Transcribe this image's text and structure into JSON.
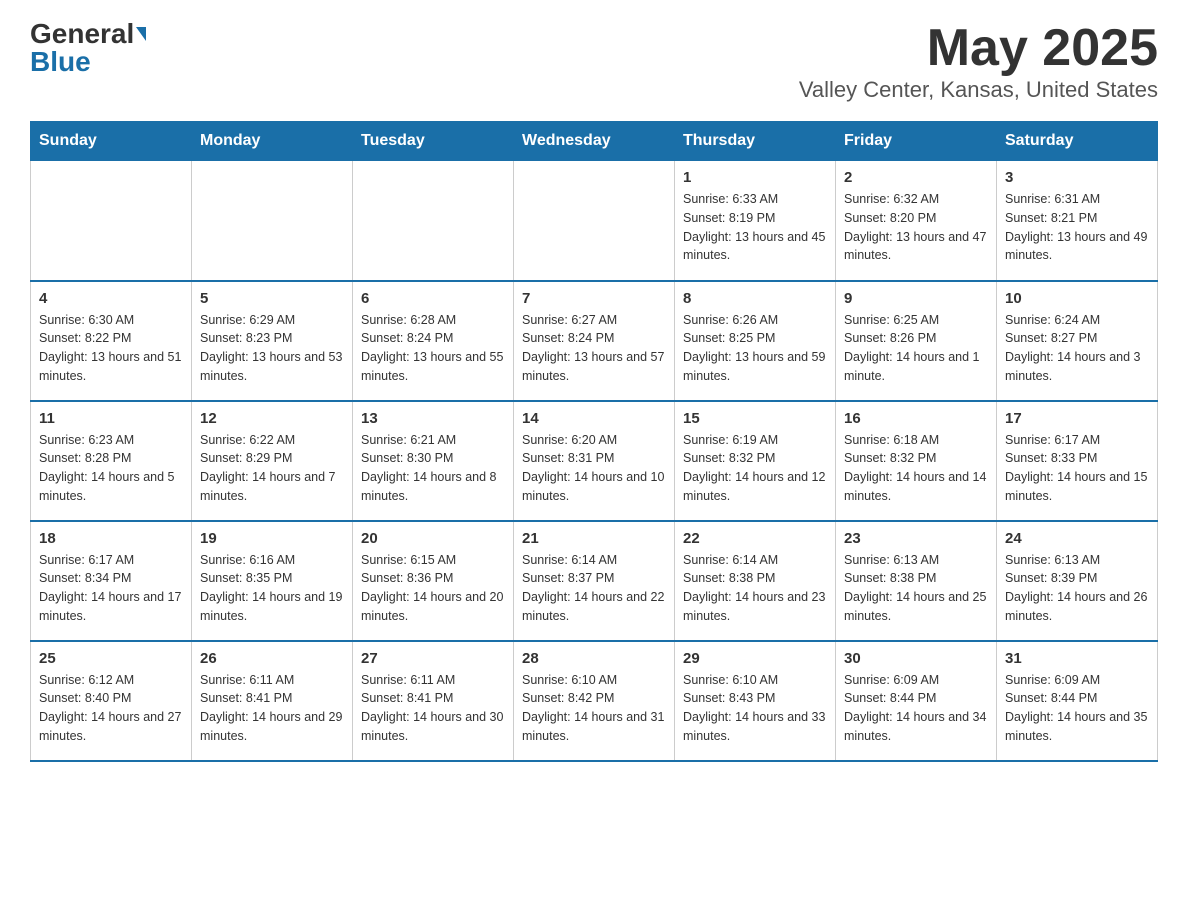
{
  "header": {
    "logo_general": "General",
    "logo_blue": "Blue",
    "month": "May 2025",
    "location": "Valley Center, Kansas, United States"
  },
  "days_of_week": [
    "Sunday",
    "Monday",
    "Tuesday",
    "Wednesday",
    "Thursday",
    "Friday",
    "Saturday"
  ],
  "weeks": [
    [
      {
        "day": "",
        "info": ""
      },
      {
        "day": "",
        "info": ""
      },
      {
        "day": "",
        "info": ""
      },
      {
        "day": "",
        "info": ""
      },
      {
        "day": "1",
        "info": "Sunrise: 6:33 AM\nSunset: 8:19 PM\nDaylight: 13 hours and 45 minutes."
      },
      {
        "day": "2",
        "info": "Sunrise: 6:32 AM\nSunset: 8:20 PM\nDaylight: 13 hours and 47 minutes."
      },
      {
        "day": "3",
        "info": "Sunrise: 6:31 AM\nSunset: 8:21 PM\nDaylight: 13 hours and 49 minutes."
      }
    ],
    [
      {
        "day": "4",
        "info": "Sunrise: 6:30 AM\nSunset: 8:22 PM\nDaylight: 13 hours and 51 minutes."
      },
      {
        "day": "5",
        "info": "Sunrise: 6:29 AM\nSunset: 8:23 PM\nDaylight: 13 hours and 53 minutes."
      },
      {
        "day": "6",
        "info": "Sunrise: 6:28 AM\nSunset: 8:24 PM\nDaylight: 13 hours and 55 minutes."
      },
      {
        "day": "7",
        "info": "Sunrise: 6:27 AM\nSunset: 8:24 PM\nDaylight: 13 hours and 57 minutes."
      },
      {
        "day": "8",
        "info": "Sunrise: 6:26 AM\nSunset: 8:25 PM\nDaylight: 13 hours and 59 minutes."
      },
      {
        "day": "9",
        "info": "Sunrise: 6:25 AM\nSunset: 8:26 PM\nDaylight: 14 hours and 1 minute."
      },
      {
        "day": "10",
        "info": "Sunrise: 6:24 AM\nSunset: 8:27 PM\nDaylight: 14 hours and 3 minutes."
      }
    ],
    [
      {
        "day": "11",
        "info": "Sunrise: 6:23 AM\nSunset: 8:28 PM\nDaylight: 14 hours and 5 minutes."
      },
      {
        "day": "12",
        "info": "Sunrise: 6:22 AM\nSunset: 8:29 PM\nDaylight: 14 hours and 7 minutes."
      },
      {
        "day": "13",
        "info": "Sunrise: 6:21 AM\nSunset: 8:30 PM\nDaylight: 14 hours and 8 minutes."
      },
      {
        "day": "14",
        "info": "Sunrise: 6:20 AM\nSunset: 8:31 PM\nDaylight: 14 hours and 10 minutes."
      },
      {
        "day": "15",
        "info": "Sunrise: 6:19 AM\nSunset: 8:32 PM\nDaylight: 14 hours and 12 minutes."
      },
      {
        "day": "16",
        "info": "Sunrise: 6:18 AM\nSunset: 8:32 PM\nDaylight: 14 hours and 14 minutes."
      },
      {
        "day": "17",
        "info": "Sunrise: 6:17 AM\nSunset: 8:33 PM\nDaylight: 14 hours and 15 minutes."
      }
    ],
    [
      {
        "day": "18",
        "info": "Sunrise: 6:17 AM\nSunset: 8:34 PM\nDaylight: 14 hours and 17 minutes."
      },
      {
        "day": "19",
        "info": "Sunrise: 6:16 AM\nSunset: 8:35 PM\nDaylight: 14 hours and 19 minutes."
      },
      {
        "day": "20",
        "info": "Sunrise: 6:15 AM\nSunset: 8:36 PM\nDaylight: 14 hours and 20 minutes."
      },
      {
        "day": "21",
        "info": "Sunrise: 6:14 AM\nSunset: 8:37 PM\nDaylight: 14 hours and 22 minutes."
      },
      {
        "day": "22",
        "info": "Sunrise: 6:14 AM\nSunset: 8:38 PM\nDaylight: 14 hours and 23 minutes."
      },
      {
        "day": "23",
        "info": "Sunrise: 6:13 AM\nSunset: 8:38 PM\nDaylight: 14 hours and 25 minutes."
      },
      {
        "day": "24",
        "info": "Sunrise: 6:13 AM\nSunset: 8:39 PM\nDaylight: 14 hours and 26 minutes."
      }
    ],
    [
      {
        "day": "25",
        "info": "Sunrise: 6:12 AM\nSunset: 8:40 PM\nDaylight: 14 hours and 27 minutes."
      },
      {
        "day": "26",
        "info": "Sunrise: 6:11 AM\nSunset: 8:41 PM\nDaylight: 14 hours and 29 minutes."
      },
      {
        "day": "27",
        "info": "Sunrise: 6:11 AM\nSunset: 8:41 PM\nDaylight: 14 hours and 30 minutes."
      },
      {
        "day": "28",
        "info": "Sunrise: 6:10 AM\nSunset: 8:42 PM\nDaylight: 14 hours and 31 minutes."
      },
      {
        "day": "29",
        "info": "Sunrise: 6:10 AM\nSunset: 8:43 PM\nDaylight: 14 hours and 33 minutes."
      },
      {
        "day": "30",
        "info": "Sunrise: 6:09 AM\nSunset: 8:44 PM\nDaylight: 14 hours and 34 minutes."
      },
      {
        "day": "31",
        "info": "Sunrise: 6:09 AM\nSunset: 8:44 PM\nDaylight: 14 hours and 35 minutes."
      }
    ]
  ]
}
